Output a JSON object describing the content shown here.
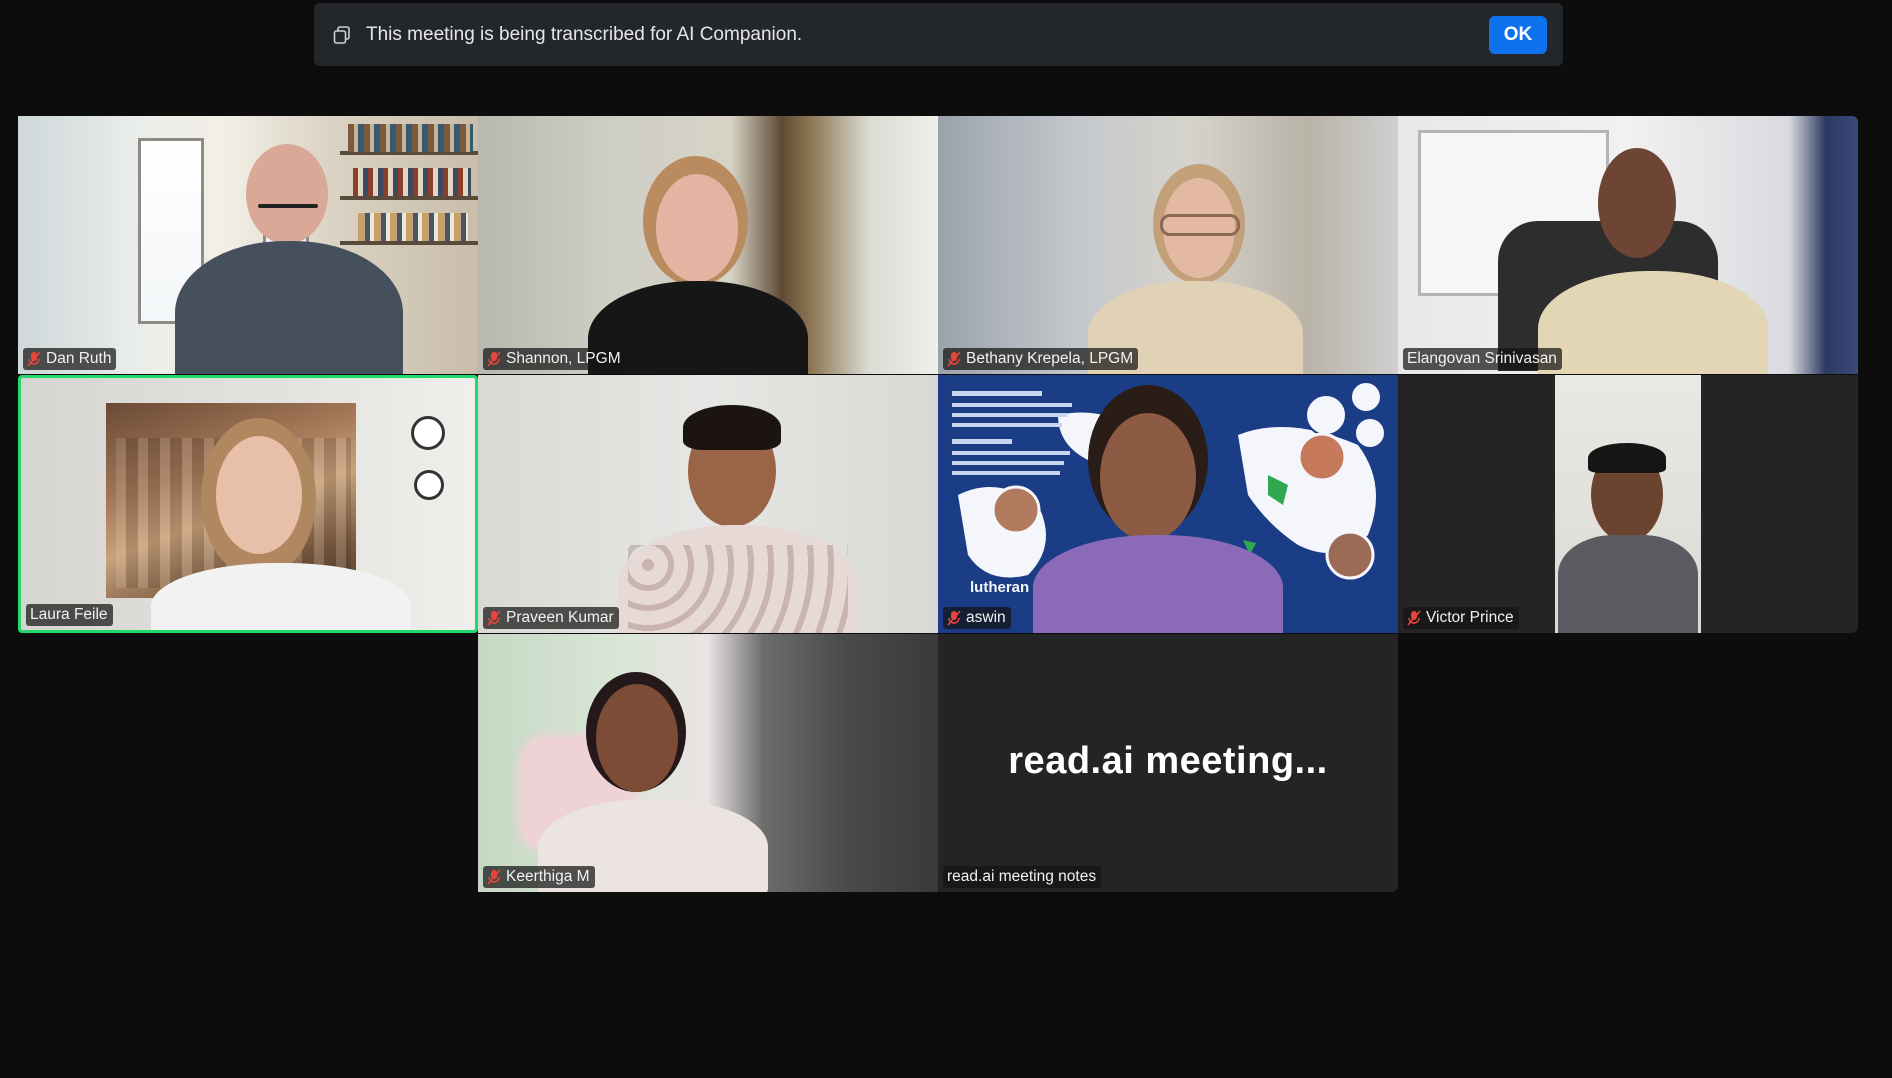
{
  "banner": {
    "message": "This meeting is being transcribed for AI Companion.",
    "ok_label": "OK",
    "icon": "copy-icon"
  },
  "participants": [
    {
      "name": "Dan Ruth",
      "muted": true
    },
    {
      "name": "Shannon, LPGM",
      "muted": true
    },
    {
      "name": "Bethany Krepela, LPGM",
      "muted": true
    },
    {
      "name": "Elangovan Srinivasan",
      "muted": false
    },
    {
      "name": "Laura Feile",
      "muted": false,
      "active_speaker": true
    },
    {
      "name": "Praveen Kumar",
      "muted": true
    },
    {
      "name": "aswin",
      "muted": true
    },
    {
      "name": "Victor Prince",
      "muted": true
    },
    {
      "name": "Keerthiga M",
      "muted": true
    },
    {
      "name": "read.ai meeting notes",
      "muted": false,
      "display_text": "read.ai  meeting..."
    }
  ],
  "aswin_background": {
    "heading": "lutheran partners"
  },
  "colors": {
    "background": "#0d0d0d",
    "banner": "#23262b",
    "ok_button": "#0e72ed",
    "active_border": "#23d96b",
    "muted_icon": "#e8453c",
    "empty_tile": "#242424"
  }
}
